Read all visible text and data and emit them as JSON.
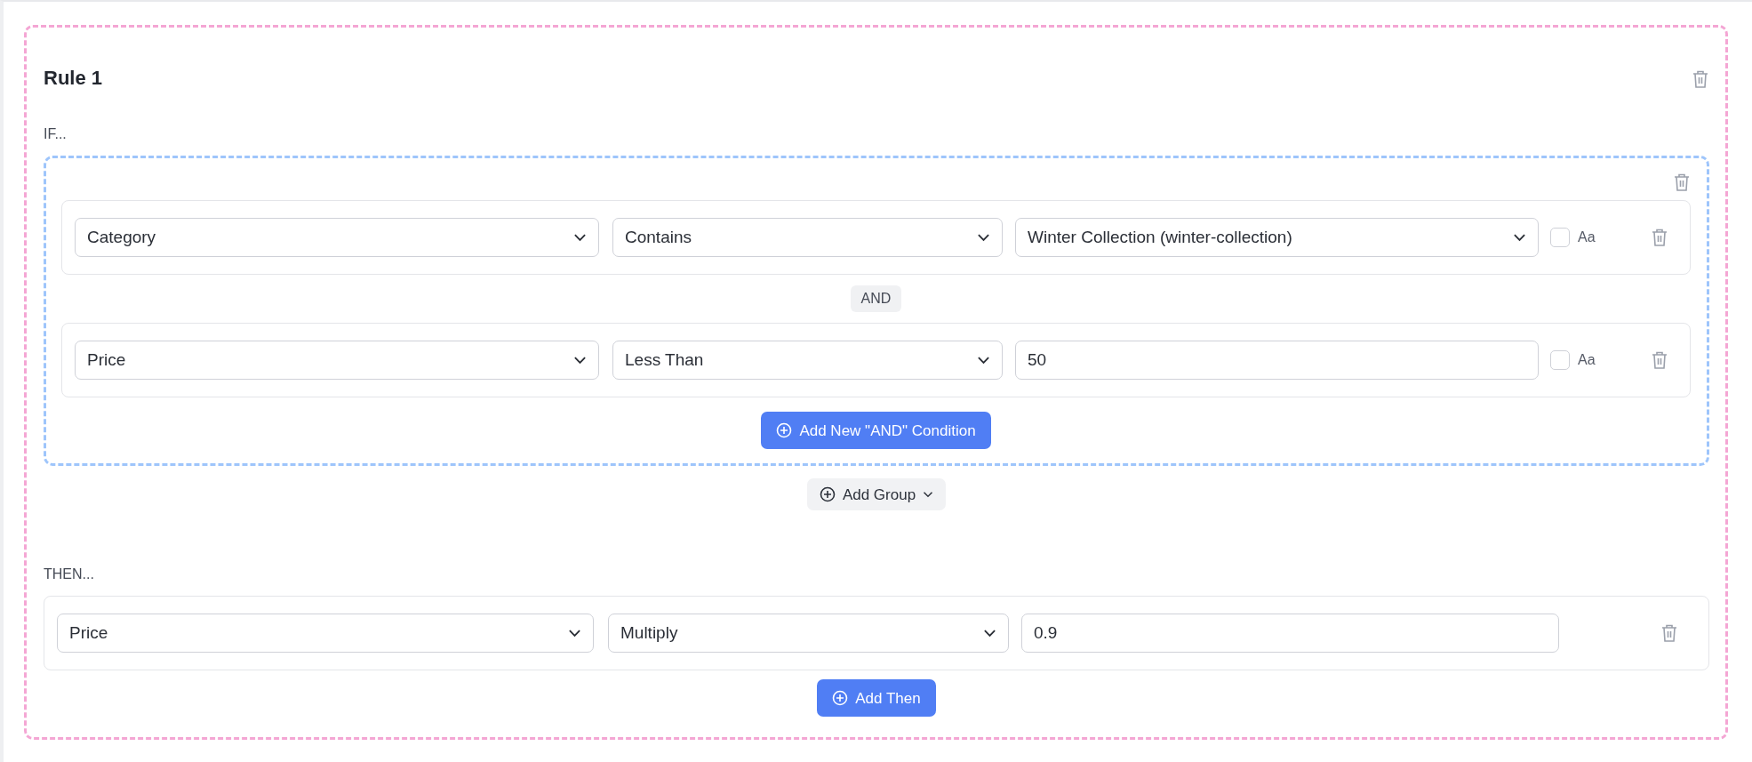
{
  "rule": {
    "title": "Rule 1",
    "if_label": "IF...",
    "groups": [
      {
        "conditions": [
          {
            "field": "Category",
            "operator": "Contains",
            "value": "Winter Collection (winter-collection)",
            "kind": "select",
            "case_sensitive": false,
            "case_label": "Aa"
          },
          {
            "field": "Price",
            "operator": "Less Than",
            "value": "50",
            "kind": "text",
            "case_sensitive": false,
            "case_label": "Aa"
          }
        ],
        "joiner": "AND",
        "add_condition": "Add New \"AND\" Condition"
      }
    ],
    "add_group": "Add Group",
    "then_label": "THEN...",
    "actions": [
      {
        "field": "Price",
        "operation": "Multiply",
        "value": "0.9"
      }
    ],
    "add_then": "Add Then"
  }
}
